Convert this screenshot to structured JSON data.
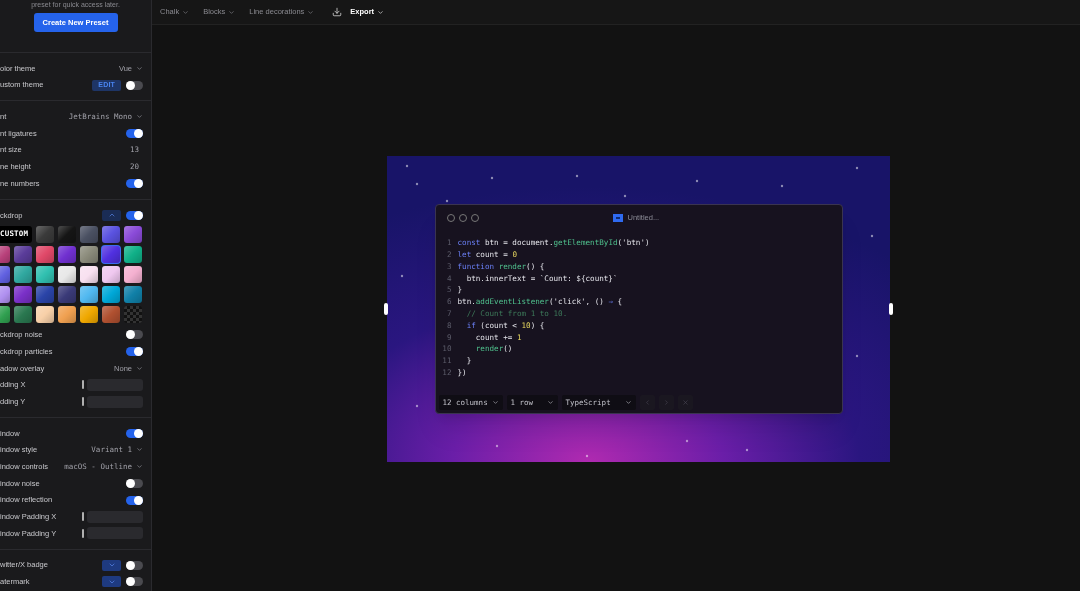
{
  "sidebar": {
    "intro": "preset for quick access later.",
    "create_button": "Create New Preset",
    "sections": [
      {
        "rows": [
          {
            "kind": "select",
            "label": "olor theme",
            "value": "Vue"
          },
          {
            "kind": "edit_toggle",
            "label": "ustom theme",
            "button": "EDIT",
            "on": false
          }
        ]
      },
      {
        "rows": [
          {
            "kind": "select",
            "label": "nt",
            "value": "JetBrains Mono",
            "mono": true
          },
          {
            "kind": "toggle",
            "label": "nt ligatures",
            "on": true
          },
          {
            "kind": "number",
            "label": "nt size",
            "value": "13"
          },
          {
            "kind": "number",
            "label": "ne height",
            "value": "20"
          },
          {
            "kind": "toggle",
            "label": "ne numbers",
            "on": true
          }
        ]
      },
      {
        "rows": [
          {
            "kind": "expand_toggle",
            "label": "ckdrop",
            "expanded": true,
            "on": true
          },
          {
            "kind": "swatches",
            "custom_label": "CUSTOM",
            "swatches": [
              {
                "kind": "gradient",
                "color": "#3a3a3a",
                "selected": false
              },
              {
                "kind": "gradient",
                "color": "#151515",
                "selected": false
              },
              {
                "kind": "gradient",
                "color": "#4a5062",
                "selected": false
              },
              {
                "kind": "gradient",
                "color": "#5a52e0",
                "selected": false
              },
              {
                "kind": "gradient",
                "color": "#8a4ad8",
                "selected": false
              },
              {
                "kind": "gradient",
                "color": "#b8407a",
                "selected": false
              },
              {
                "kind": "gradient",
                "color": "#5a3c9a",
                "selected": false
              },
              {
                "kind": "gradient",
                "color": "#e04868",
                "selected": false
              },
              {
                "kind": "gradient",
                "color": "#7030d0",
                "selected": false
              },
              {
                "kind": "gradient",
                "color": "#8a8a7a",
                "selected": false
              },
              {
                "kind": "gradient",
                "color": "#5030e0",
                "selected": true
              },
              {
                "kind": "gradient",
                "color": "#10b088",
                "selected": false
              },
              {
                "kind": "gradient",
                "color": "#6060e0",
                "selected": false
              },
              {
                "kind": "gradient",
                "color": "#30a8a0",
                "selected": false
              },
              {
                "kind": "gradient",
                "color": "#30c0b0",
                "selected": false
              },
              {
                "kind": "gradient",
                "color": "#e8e8e8",
                "selected": false
              },
              {
                "kind": "gradient",
                "color": "#f8e0f0",
                "selected": false
              },
              {
                "kind": "gradient",
                "color": "#f0c8f0",
                "selected": false
              },
              {
                "kind": "gradient",
                "color": "#f4b0d0",
                "selected": false
              },
              {
                "kind": "gradient",
                "color": "#b090f0",
                "selected": false
              },
              {
                "kind": "gradient",
                "color": "#7a30c8",
                "selected": false
              },
              {
                "kind": "gradient",
                "color": "#2a44a8",
                "selected": false
              },
              {
                "kind": "gradient",
                "color": "#3a3a78",
                "selected": false
              },
              {
                "kind": "gradient",
                "color": "#50b8f0",
                "selected": false
              },
              {
                "kind": "gradient",
                "color": "#00a8d8",
                "selected": false
              },
              {
                "kind": "gradient",
                "color": "#1080a8",
                "selected": false
              },
              {
                "kind": "gradient",
                "color": "#30a050",
                "selected": false
              },
              {
                "kind": "gradient",
                "color": "#2a7850",
                "selected": false
              },
              {
                "kind": "gradient",
                "color": "#f8d0a8",
                "selected": false
              },
              {
                "kind": "gradient",
                "color": "#f0a050",
                "selected": false
              },
              {
                "kind": "gradient",
                "color": "#f0a800",
                "selected": false
              },
              {
                "kind": "gradient",
                "color": "#b05030",
                "selected": false
              },
              {
                "kind": "checker",
                "color": "#222222",
                "selected": false
              }
            ]
          },
          {
            "kind": "toggle",
            "label": "ckdrop noise",
            "on": false
          },
          {
            "kind": "toggle",
            "label": "ckdrop particles",
            "on": true
          },
          {
            "kind": "select",
            "label": "adow overlay",
            "value": "None"
          },
          {
            "kind": "slider",
            "label": "dding X",
            "level": 0
          },
          {
            "kind": "slider",
            "label": "dding Y",
            "level": 0
          }
        ]
      },
      {
        "rows": [
          {
            "kind": "toggle",
            "label": "indow",
            "on": true
          },
          {
            "kind": "select",
            "label": "indow style",
            "value": "Variant 1",
            "mono": true
          },
          {
            "kind": "select",
            "label": "indow controls",
            "value": "macOS - Outline",
            "mono": true
          },
          {
            "kind": "toggle",
            "label": "indow noise",
            "on": false
          },
          {
            "kind": "toggle",
            "label": "indow reflection",
            "on": true
          },
          {
            "kind": "slider",
            "label": "indow Padding X",
            "level": 0
          },
          {
            "kind": "slider",
            "label": "indow Padding Y",
            "level": 0
          }
        ]
      },
      {
        "rows": [
          {
            "kind": "expand_toggle",
            "label": "witter/X badge",
            "expanded": false,
            "on": false
          },
          {
            "kind": "expand_toggle",
            "label": "atermark",
            "expanded": false,
            "on": false
          }
        ]
      }
    ]
  },
  "toolbar": {
    "menus": [
      {
        "label": "Chalk",
        "kind": "menu"
      },
      {
        "label": "Blocks",
        "kind": "menu"
      },
      {
        "label": "Line decorations",
        "kind": "menu"
      },
      {
        "label": "Export",
        "kind": "export"
      }
    ]
  },
  "editor": {
    "title": "Untitled...",
    "lines": [
      {
        "number": "1",
        "tokens": [
          {
            "kind": "keyword",
            "text": "const"
          },
          {
            "kind": "plain",
            "text": " btn = document."
          },
          {
            "kind": "function",
            "text": "getElementById"
          },
          {
            "kind": "plain",
            "text": "('btn')"
          }
        ]
      },
      {
        "number": "2",
        "tokens": [
          {
            "kind": "keyword",
            "text": "let"
          },
          {
            "kind": "plain",
            "text": " count = "
          },
          {
            "kind": "number",
            "text": "0"
          }
        ]
      },
      {
        "number": "3",
        "tokens": [
          {
            "kind": "keyword",
            "text": "function"
          },
          {
            "kind": "function",
            "text": " render"
          },
          {
            "kind": "plain",
            "text": "() {"
          }
        ]
      },
      {
        "number": "4",
        "tokens": [
          {
            "kind": "plain",
            "text": "  btn.innerText = `Count: ${count}`"
          }
        ]
      },
      {
        "number": "5",
        "tokens": [
          {
            "kind": "plain",
            "text": "}"
          }
        ]
      },
      {
        "number": "6",
        "tokens": [
          {
            "kind": "plain",
            "text": "btn."
          },
          {
            "kind": "function",
            "text": "addEventListener"
          },
          {
            "kind": "plain",
            "text": "('click', () "
          },
          {
            "kind": "keyword",
            "text": "⇒"
          },
          {
            "kind": "plain",
            "text": " {"
          }
        ]
      },
      {
        "number": "7",
        "tokens": [
          {
            "kind": "comment",
            "text": "  // Count from 1 to 10."
          }
        ]
      },
      {
        "number": "8",
        "tokens": [
          {
            "kind": "keyword",
            "text": "  if"
          },
          {
            "kind": "plain",
            "text": " (count < "
          },
          {
            "kind": "number",
            "text": "10"
          },
          {
            "kind": "plain",
            "text": ") {"
          }
        ]
      },
      {
        "number": "9",
        "tokens": [
          {
            "kind": "plain",
            "text": "    count += "
          },
          {
            "kind": "number",
            "text": "1"
          }
        ]
      },
      {
        "number": "10",
        "tokens": [
          {
            "kind": "function",
            "text": "    render"
          },
          {
            "kind": "plain",
            "text": "()"
          }
        ]
      },
      {
        "number": "11",
        "tokens": [
          {
            "kind": "plain",
            "text": "  }"
          }
        ]
      },
      {
        "number": "12",
        "tokens": [
          {
            "kind": "plain",
            "text": "})"
          }
        ]
      }
    ],
    "footer": {
      "selects": [
        "12 columns",
        "1 row",
        "TypeScript"
      ],
      "nav_disabled": true
    }
  }
}
